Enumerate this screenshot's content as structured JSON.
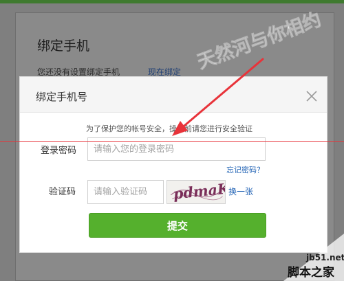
{
  "background": {
    "title": "绑定手机",
    "notice": "您还没有设置绑定手机",
    "link": "现在绑定"
  },
  "watermark": {
    "text": "天然河与你相约"
  },
  "dialog": {
    "title": "绑定手机号",
    "close_icon": "close-icon",
    "security_note": "为了保护您的帐号安全，操作前请您进行安全验证",
    "password": {
      "label": "登录密码",
      "placeholder": "请输入您的登录密码",
      "value": ""
    },
    "forgot_password": "忘记密码？",
    "captcha": {
      "label": "验证码",
      "placeholder": "请输入验证码",
      "value": "",
      "image_text": "pdmaK"
    },
    "refresh_captcha": "换一张",
    "submit": "提交"
  },
  "site_mark": {
    "url": "jb51.net",
    "name": "脚本之家"
  },
  "colors": {
    "accent_green": "#55b02d",
    "link_blue": "#1f61b4",
    "annotation_red": "#e8333a"
  }
}
